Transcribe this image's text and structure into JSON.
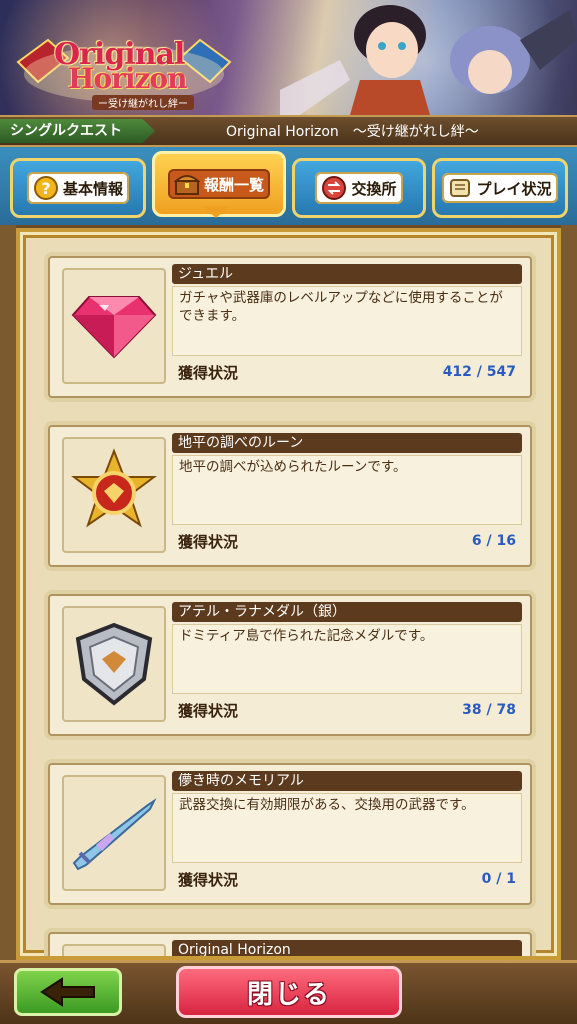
{
  "banner": {
    "logo_line1": "Original",
    "logo_line2": "Horizon",
    "logo_sub": "ー受け継がれし絆ー"
  },
  "titlebar": {
    "mode": "シングルクエスト",
    "quest_title": "Original Horizon　～受け継がれし絆～"
  },
  "tabs": [
    {
      "label": "基本情報",
      "icon": "question-icon",
      "active": false
    },
    {
      "label": "報酬一覧",
      "icon": "treasure-chest-icon",
      "active": true
    },
    {
      "label": "交換所",
      "icon": "exchange-icon",
      "active": false
    },
    {
      "label": "プレイ状況",
      "icon": "scroll-icon",
      "active": false
    }
  ],
  "status_label": "獲得状況",
  "items": [
    {
      "name": "ジュエル",
      "desc": "ガチャや武器庫のレベルアップなどに使用することができます。",
      "progress": "412 / 547",
      "icon": "jewel-icon"
    },
    {
      "name": "地平の調べのルーン",
      "desc": "地平の調べが込められたルーンです。",
      "progress": "6 / 16",
      "icon": "rune-medal-icon"
    },
    {
      "name": "アテル・ラナメダル（銀）",
      "desc": "ドミティア島で作られた記念メダルです。",
      "progress": "38 / 78",
      "icon": "silver-medal-icon"
    },
    {
      "name": "儚き時のメモリアル",
      "desc": "武器交換に有効期限がある、交換用の武器です。",
      "progress": "0 / 1",
      "icon": "sword-icon"
    },
    {
      "name": "Original Horizon",
      "desc": "",
      "progress": "",
      "icon": ""
    }
  ],
  "bottom": {
    "close_label": "閉じる"
  },
  "colors": {
    "accent_blue": "#2a5bc0",
    "close_red": "#d7243f",
    "back_green": "#3c9a24",
    "item_header": "#5b3a1d"
  }
}
